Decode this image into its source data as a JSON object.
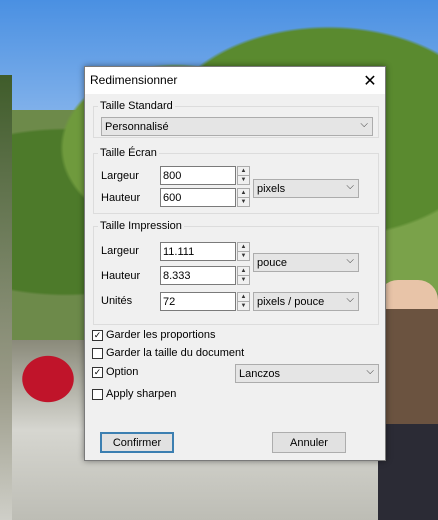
{
  "dialog": {
    "title": "Redimensionner",
    "close_icon": "close-icon"
  },
  "standard": {
    "legend": "Taille Standard",
    "preset": "Personnalisé"
  },
  "screen": {
    "legend": "Taille Écran",
    "width_label": "Largeur",
    "width_value": "800",
    "height_label": "Hauteur",
    "height_value": "600",
    "unit": "pixels"
  },
  "print": {
    "legend": "Taille Impression",
    "width_label": "Largeur",
    "width_value": "11.111",
    "height_label": "Hauteur",
    "height_value": "8.333",
    "unit": "pouce",
    "resolution_label": "Unités",
    "resolution_value": "72",
    "resolution_unit": "pixels / pouce"
  },
  "options": {
    "keep_proportions": {
      "label": "Garder les proportions",
      "checked": true
    },
    "keep_doc_size": {
      "label": "Garder la taille du document",
      "checked": false
    },
    "option": {
      "label": "Option",
      "checked": true,
      "filter": "Lanczos"
    },
    "apply_sharpen": {
      "label": "Apply sharpen",
      "checked": false
    }
  },
  "buttons": {
    "confirm": "Confirmer",
    "cancel": "Annuler"
  }
}
